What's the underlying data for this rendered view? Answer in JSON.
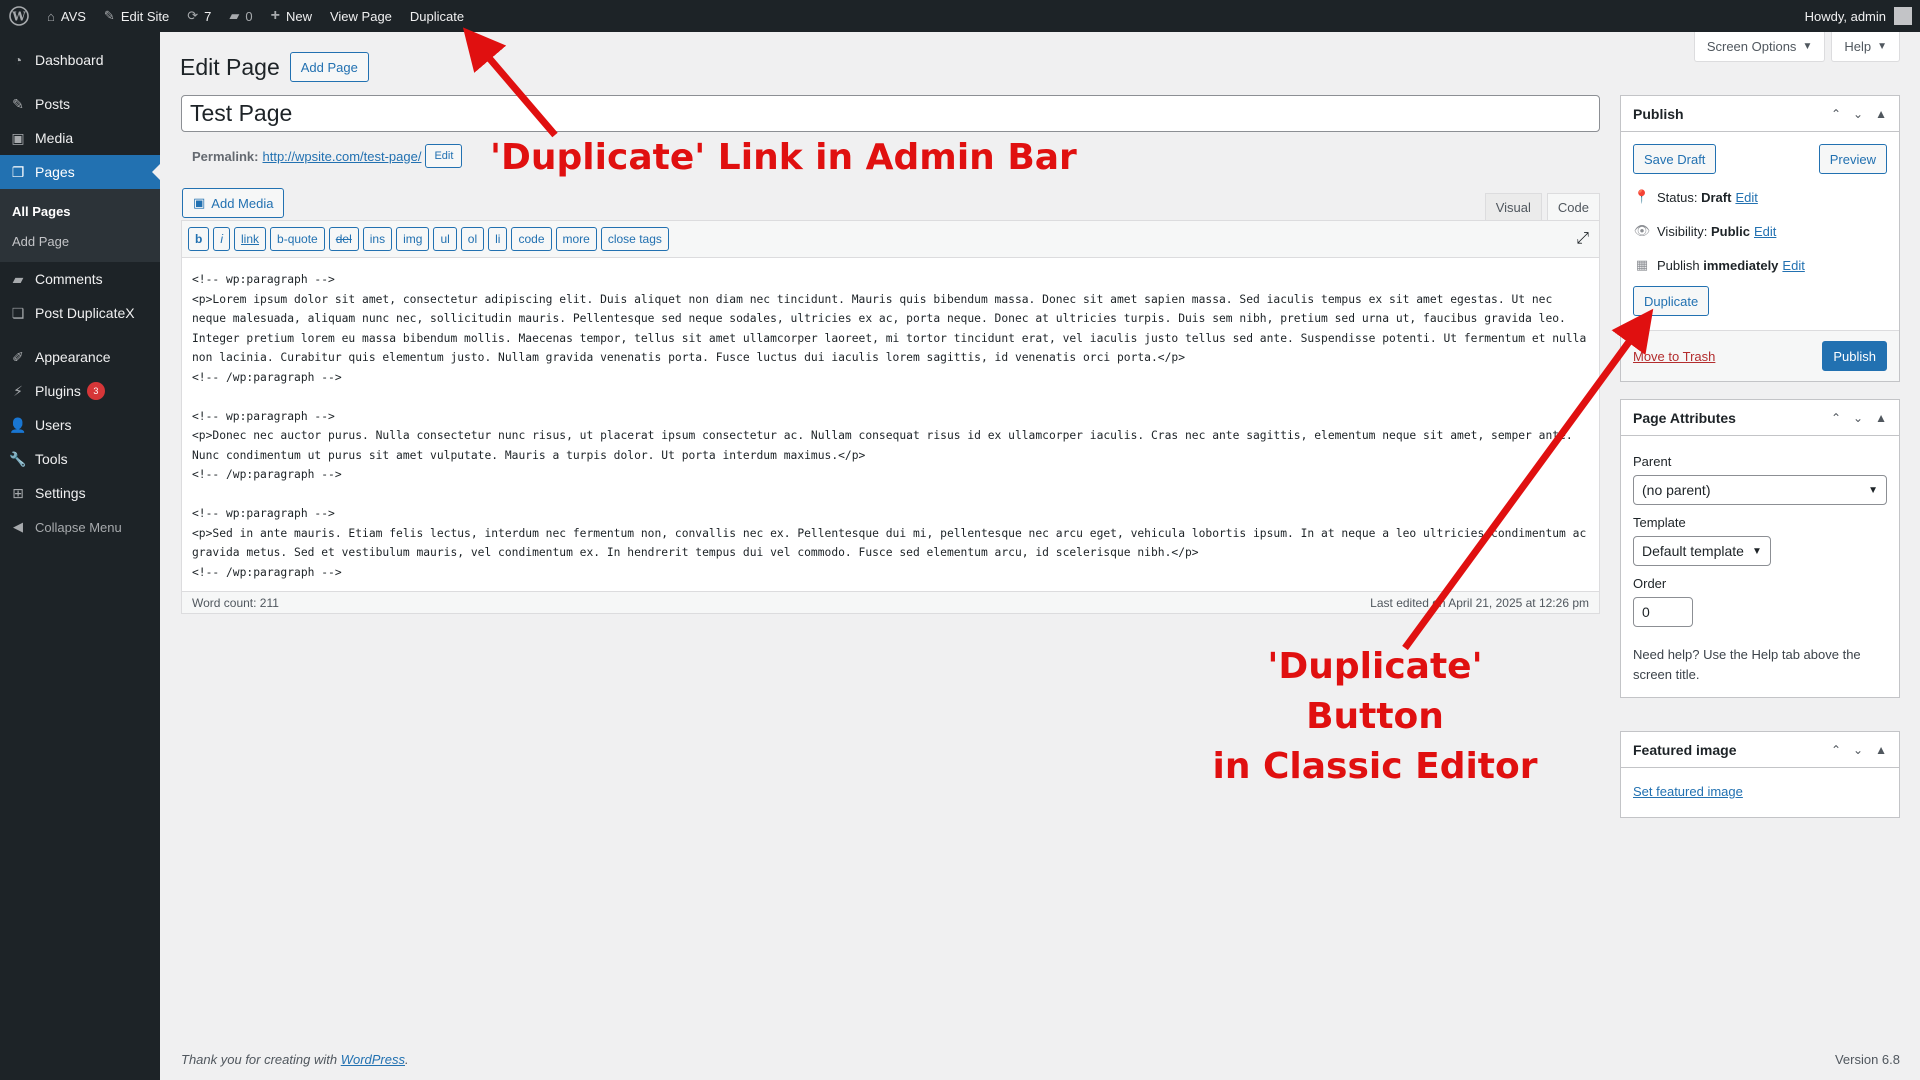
{
  "admin_bar": {
    "site_name": "AVS",
    "edit_site": "Edit Site",
    "updates_count": "7",
    "comments_count": "0",
    "new_label": "New",
    "view_page": "View Page",
    "duplicate": "Duplicate",
    "howdy": "Howdy, admin"
  },
  "sidebar": {
    "items": [
      {
        "label": "Dashboard",
        "icon": "dashboard-icon"
      },
      {
        "label": "Posts",
        "icon": "pin-icon"
      },
      {
        "label": "Media",
        "icon": "media-icon"
      },
      {
        "label": "Pages",
        "icon": "pages-icon"
      },
      {
        "label": "Comments",
        "icon": "comments-icon"
      },
      {
        "label": "Post DuplicateX",
        "icon": "copy-icon"
      },
      {
        "label": "Appearance",
        "icon": "brush-icon"
      },
      {
        "label": "Plugins",
        "icon": "plugin-icon",
        "badge": "3"
      },
      {
        "label": "Users",
        "icon": "users-icon"
      },
      {
        "label": "Tools",
        "icon": "wrench-icon"
      },
      {
        "label": "Settings",
        "icon": "settings-icon"
      }
    ],
    "submenu": {
      "all_pages": "All Pages",
      "add_page": "Add Page"
    },
    "collapse": "Collapse Menu"
  },
  "screen_meta": {
    "screen_options": "Screen Options",
    "help": "Help"
  },
  "page": {
    "heading": "Edit Page",
    "add_new": "Add Page",
    "title_value": "Test Page",
    "permalink_label": "Permalink:",
    "permalink_base": "http://wpsite.com/",
    "permalink_slug": "test-page/",
    "permalink_edit": "Edit",
    "add_media": "Add Media"
  },
  "editor": {
    "tabs": {
      "visual": "Visual",
      "code": "Code"
    },
    "quicktags": [
      "b",
      "i",
      "link",
      "b-quote",
      "del",
      "ins",
      "img",
      "ul",
      "ol",
      "li",
      "code",
      "more",
      "close tags"
    ],
    "content": "<!-- wp:paragraph -->\n<p>Lorem ipsum dolor sit amet, consectetur adipiscing elit. Duis aliquet non diam nec tincidunt. Mauris quis bibendum massa. Donec sit amet sapien massa. Sed iaculis tempus ex sit amet egestas. Ut nec neque malesuada, aliquam nunc nec, sollicitudin mauris. Pellentesque sed neque sodales, ultricies ex ac, porta neque. Donec at ultricies turpis. Duis sem nibh, pretium sed urna ut, faucibus gravida leo. Integer pretium lorem eu massa bibendum mollis. Maecenas tempor, tellus sit amet ullamcorper laoreet, mi tortor tincidunt erat, vel iaculis justo tellus sed ante. Suspendisse potenti. Ut fermentum et nulla non lacinia. Curabitur quis elementum justo. Nullam gravida venenatis porta. Fusce luctus dui iaculis lorem sagittis, id venenatis orci porta.</p>\n<!-- /wp:paragraph -->\n\n<!-- wp:paragraph -->\n<p>Donec nec auctor purus. Nulla consectetur nunc risus, ut placerat ipsum consectetur ac. Nullam consequat risus id ex ullamcorper iaculis. Cras nec ante sagittis, elementum neque sit amet, semper ante. Nunc condimentum ut purus sit amet vulputate. Mauris a turpis dolor. Ut porta interdum maximus.</p>\n<!-- /wp:paragraph -->\n\n<!-- wp:paragraph -->\n<p>Sed in ante mauris. Etiam felis lectus, interdum nec fermentum non, convallis nec ex. Pellentesque dui mi, pellentesque nec arcu eget, vehicula lobortis ipsum. In at neque a leo ultricies condimentum ac gravida metus. Sed et vestibulum mauris, vel condimentum ex. In hendrerit tempus dui vel commodo. Fusce sed elementum arcu, id scelerisque nibh.</p>\n<!-- /wp:paragraph -->",
    "word_count": "Word count: 211",
    "last_edited": "Last edited on April 21, 2025 at 12:26 pm"
  },
  "publish_box": {
    "title": "Publish",
    "save_draft": "Save Draft",
    "preview": "Preview",
    "status_label": "Status:",
    "status_value": "Draft",
    "visibility_label": "Visibility:",
    "visibility_value": "Public",
    "publish_label": "Publish",
    "publish_value": "immediately",
    "edit": "Edit",
    "duplicate": "Duplicate",
    "move_to_trash": "Move to Trash",
    "publish_button": "Publish"
  },
  "page_attributes": {
    "title": "Page Attributes",
    "parent_label": "Parent",
    "parent_value": "(no parent)",
    "template_label": "Template",
    "template_value": "Default template",
    "order_label": "Order",
    "order_value": "0",
    "help_text": "Need help? Use the Help tab above the screen title."
  },
  "featured_image": {
    "title": "Featured image",
    "set_link": "Set featured image"
  },
  "footer": {
    "thank_you": "Thank you for creating with",
    "wordpress": "WordPress",
    "period": ".",
    "version": "Version 6.8"
  },
  "annotations": {
    "admin_bar_note": "'Duplicate' Link in Admin Bar",
    "classic_editor_line1": "'Duplicate' Button",
    "classic_editor_line2": "in Classic Editor"
  },
  "colors": {
    "admin_bar": "#1d2327",
    "accent": "#2271b1",
    "annotation": "#e01010",
    "trash": "#b32d2e",
    "badge": "#d63638"
  }
}
